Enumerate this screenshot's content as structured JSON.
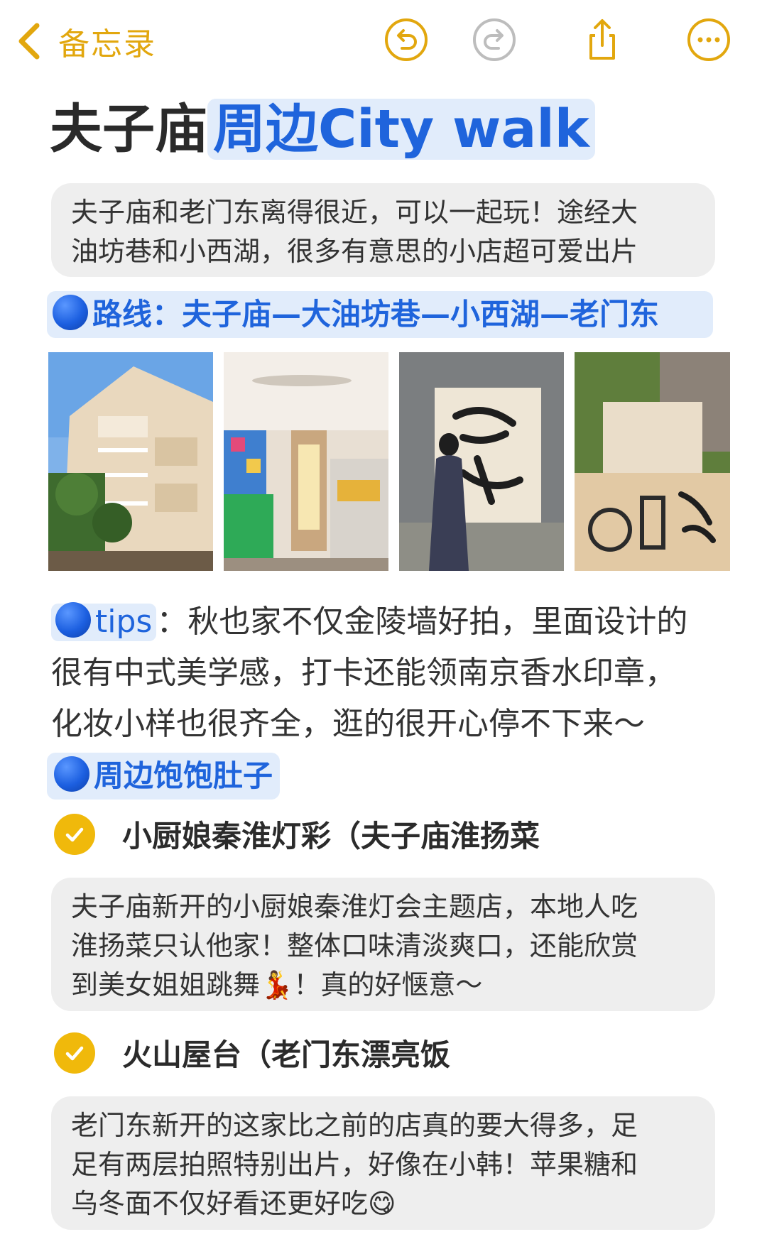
{
  "app": {
    "back_label": "备忘录",
    "accent": "#E2A70E",
    "toolbar_icons": [
      "undo-icon",
      "redo-icon",
      "share-icon",
      "more-icon"
    ]
  },
  "note": {
    "title_plain": "夫子庙",
    "title_highlight": "周边City walk",
    "intro": [
      "夫子庙和老门东离得很近，可以一起玩！途经大",
      "油坊巷和小西湖，很多有意思的小店超可爱出片"
    ],
    "route": "路线：夫子庙—大油坊巷—小西湖—老门东",
    "photos": [
      "building-photo",
      "cafe-interior-photo",
      "jinling-wall-photo",
      "perfume-bag-photo"
    ],
    "tips": {
      "tag": "tips",
      "lines": [
        "：秋也家不仅金陵墙好拍，里面设计的",
        "很有中式美学感，打卡还能领南京香水印章，",
        "化妆小样也很齐全，逛的很开心停不下来～"
      ]
    },
    "eat_heading": "周边饱饱肚子",
    "restaurants": [
      {
        "name": "小厨娘秦淮灯彩（夫子庙淮扬菜",
        "desc": [
          "夫子庙新开的小厨娘秦淮灯会主题店，本地人吃",
          "淮扬菜只认他家！整体口味清淡爽口，还能欣赏",
          "到美女姐姐跳舞💃！真的好惬意～"
        ]
      },
      {
        "name": "火山屋台（老门东漂亮饭",
        "desc": [
          "老门东新开的这家比之前的店真的要大得多，足",
          "足有两层拍照特别出片，好像在小韩！苹果糖和",
          "乌冬面不仅好看还更好吃😋"
        ]
      }
    ]
  },
  "colors": {
    "highlight_bg": "#E1ECFB",
    "highlight_text": "#1F64DC",
    "card_bg": "#EEEEEE"
  }
}
